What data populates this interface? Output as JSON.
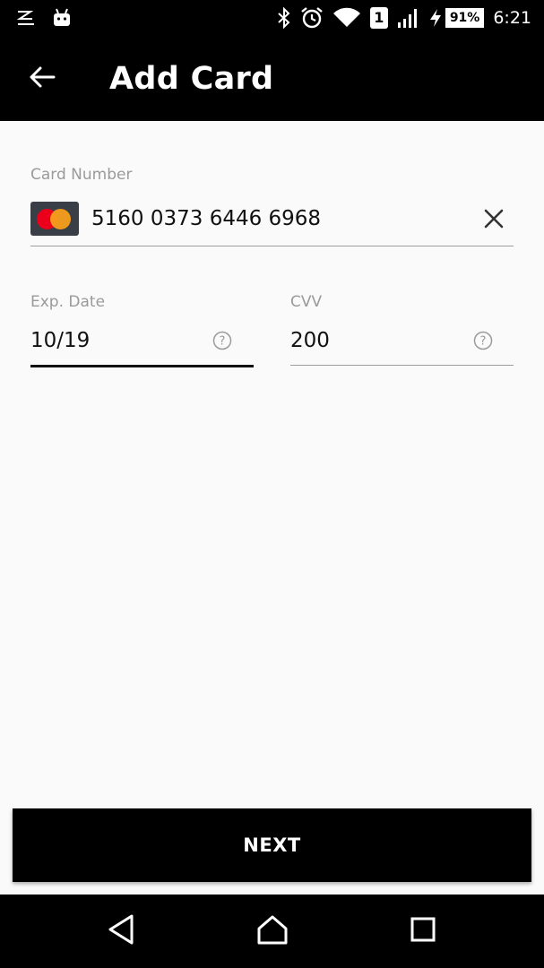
{
  "status_bar": {
    "battery": "91%",
    "sim_slot": "1",
    "time": "6:21",
    "icons": [
      "nfc-icon",
      "android-icon",
      "bluetooth-icon",
      "alarm-icon",
      "wifi-icon",
      "sim-icon",
      "signal-icon",
      "charging-icon",
      "battery-icon"
    ]
  },
  "app_bar": {
    "title": "Add Card",
    "back_icon": "arrow-left-icon"
  },
  "form": {
    "card_number": {
      "label": "Card Number",
      "value": "5160 0373 6446 6968",
      "brand": "mastercard",
      "clear_icon": "close-icon"
    },
    "exp_date": {
      "label": "Exp. Date",
      "value": "10/19",
      "help_icon": "help-circle-icon"
    },
    "cvv": {
      "label": "CVV",
      "value": "200",
      "help_icon": "help-circle-icon"
    }
  },
  "actions": {
    "next_label": "NEXT"
  },
  "nav_bar": {
    "items": [
      "back-triangle-icon",
      "home-icon",
      "recents-icon"
    ]
  },
  "colors": {
    "app_bar": "#000000",
    "background": "#fafafa",
    "label": "#9a9a9a",
    "mastercard_red": "#eb001b",
    "mastercard_orange": "#f79e1b"
  }
}
